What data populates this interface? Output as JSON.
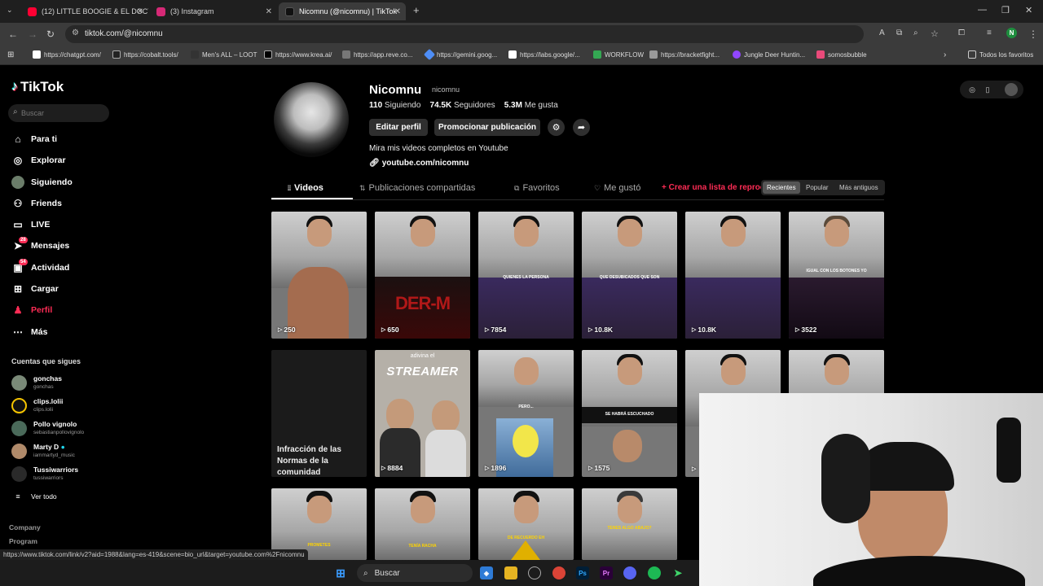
{
  "browser": {
    "tabs": [
      {
        "label": "(12) LITTLE BOOGIE & EL DOCT",
        "fav_color": "#ff0033"
      },
      {
        "label": "(3) Instagram",
        "fav_color": "#d62976"
      },
      {
        "label": "Nicomnu (@nicomnu) | TikTok",
        "fav_color": "#111111"
      }
    ],
    "new_tab": "+",
    "url": "tiktok.com/@nicomnu",
    "bookmarks": [
      "https://chatgpt.com/",
      "https://cobalt.tools/",
      "Men's ALL – LOOT",
      "https://www.krea.ai/",
      "https://app.reve.co...",
      "https://gemini.goog...",
      "https://labs.google/...",
      "WORKFLOW",
      "https://bracketfight...",
      "Jungle Deer Huntin...",
      "somosbubble"
    ],
    "all_bookmarks": "Todos los favoritos",
    "profile_initial": "N"
  },
  "tiktok": {
    "logo": "TikTok",
    "search_placeholder": "Buscar",
    "nav": [
      {
        "label": "Para ti",
        "icon": "home-icon"
      },
      {
        "label": "Explorar",
        "icon": "compass-icon"
      },
      {
        "label": "Siguiendo",
        "icon": "following-icon"
      },
      {
        "label": "Friends",
        "icon": "friends-icon"
      },
      {
        "label": "LIVE",
        "icon": "live-icon"
      },
      {
        "label": "Mensajes",
        "icon": "message-icon",
        "badge": "28"
      },
      {
        "label": "Actividad",
        "icon": "activity-icon",
        "badge": "54"
      },
      {
        "label": "Cargar",
        "icon": "upload-icon"
      },
      {
        "label": "Perfil",
        "icon": "profile-icon"
      },
      {
        "label": "Más",
        "icon": "more-icon"
      }
    ],
    "following_title": "Cuentas que sigues",
    "following": [
      {
        "name": "gonchas",
        "handle": "gonchas"
      },
      {
        "name": "clips.lolii",
        "handle": "clips.lolii"
      },
      {
        "name": "Pollo vignolo",
        "handle": "sebastianpollovignolo"
      },
      {
        "name": "Marty D",
        "handle": "iammartyd_music"
      },
      {
        "name": "Tussiwarriors",
        "handle": "tussiwarriors"
      }
    ],
    "see_all": "Ver todo",
    "footer": [
      "Company",
      "Program"
    ]
  },
  "profile": {
    "name": "Nicomnu",
    "username": "nicomnu",
    "following_count": "110",
    "following_label": "Siguiendo",
    "followers_count": "74.5K",
    "followers_label": "Seguidores",
    "likes_count": "5.3M",
    "likes_label": "Me gusta",
    "edit_button": "Editar perfil",
    "promote_button": "Promocionar publicación",
    "bio": "Mira mis videos completos en Youtube",
    "link": "youtube.com/nicomnu",
    "tabs": [
      "Videos",
      "Publicaciones compartidas",
      "Favoritos",
      "Me gustó"
    ],
    "create_playlist": "Crear una lista de reproducción",
    "sort": [
      "Recientes",
      "Popular",
      "Más antiguos"
    ]
  },
  "videos": [
    {
      "views": "250"
    },
    {
      "views": "650",
      "overlay": "DER-M"
    },
    {
      "views": "7854",
      "caption": "QUIENES LA PERSONA"
    },
    {
      "views": "10.8K",
      "caption": "QUE DESUBICADOS QUE SON"
    },
    {
      "views": "10.8K"
    },
    {
      "views": "3522",
      "caption": "IGUAL CON LOS BOTONES YO"
    },
    {
      "restricted": "Infracción de las Normas de la comunidad"
    },
    {
      "views": "8884",
      "top_text": "adivina el",
      "big_text": "STREAMER"
    },
    {
      "views": "1896",
      "caption": "PERO..."
    },
    {
      "views": "1575",
      "caption": "SE HABRÁ ESCUCHADO"
    },
    {
      "views": ""
    },
    {
      "views": ""
    },
    {
      "caption": "PROMETES"
    },
    {
      "caption": "TENÍA RACHA"
    },
    {
      "caption": "DE RECUERDO EH"
    },
    {
      "caption": "TENES ALGO ABAJO?"
    }
  ],
  "status_url": "https://www.tiktok.com/link/v2?aid=1988&lang=es-419&scene=bio_url&target=youtube.com%2Fnicomnu",
  "taskbar": {
    "search": "Buscar"
  }
}
